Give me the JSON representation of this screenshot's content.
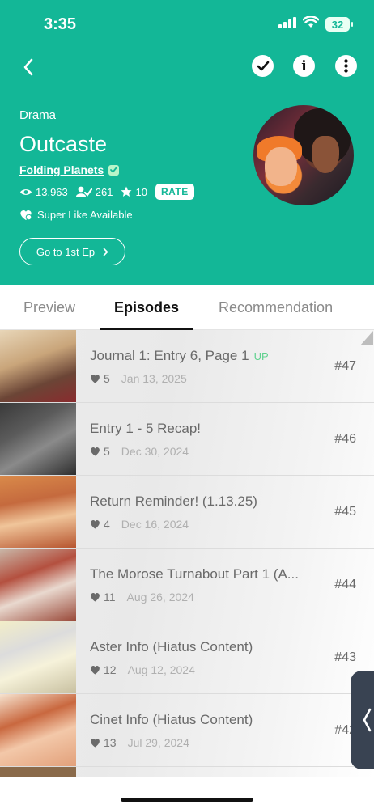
{
  "status": {
    "time": "3:35",
    "battery": "32"
  },
  "series": {
    "genre": "Drama",
    "title": "Outcaste",
    "author": "Folding Planets",
    "views": "13,963",
    "subscribers": "261",
    "rating": "10",
    "rate_label": "RATE",
    "superlike_label": "Super Like Available",
    "first_ep_label": "Go to 1st Ep"
  },
  "tabs": [
    "Preview",
    "Episodes",
    "Recommendation"
  ],
  "active_tab": "Episodes",
  "episodes": [
    {
      "title": "Journal 1: Entry 6, Page 1",
      "badge": "UP",
      "likes": "5",
      "date": "Jan 13, 2025",
      "number": "#47"
    },
    {
      "title": "Entry 1 - 5 Recap!",
      "likes": "5",
      "date": "Dec 30, 2024",
      "number": "#46"
    },
    {
      "title": "Return Reminder! (1.13.25)",
      "likes": "4",
      "date": "Dec 16, 2024",
      "number": "#45"
    },
    {
      "title": "The Morose Turnabout Part 1 (A...",
      "likes": "11",
      "date": "Aug 26, 2024",
      "number": "#44"
    },
    {
      "title": "Aster Info (Hiatus Content)",
      "likes": "12",
      "date": "Aug 12, 2024",
      "number": "#43"
    },
    {
      "title": "Cinet Info (Hiatus Content)",
      "likes": "13",
      "date": "Jul 29, 2024",
      "number": "#42"
    }
  ],
  "colors": {
    "brand": "#13b797",
    "upBadge": "#5fd18e",
    "handle": "#394352"
  }
}
